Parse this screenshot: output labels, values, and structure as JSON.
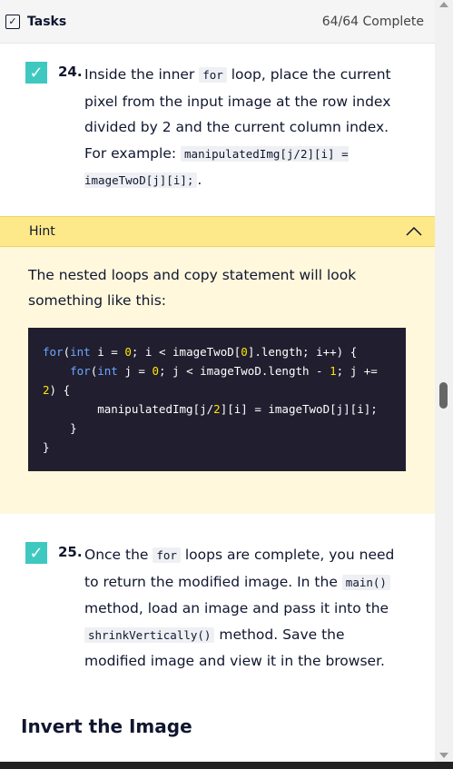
{
  "header": {
    "title": "Tasks",
    "progress": "64/64 Complete"
  },
  "task24": {
    "number": "24.",
    "text_1": "Inside the inner ",
    "code_1": "for",
    "text_2": " loop, place the current pixel from the input image at the row index divided by 2 and the current column index. For example: ",
    "code_2": "manipulatedImg[j/2][i] = imageTwoD[j][i];",
    "text_3": "."
  },
  "hint": {
    "label": "Hint",
    "text": "The nested loops and copy statement will look something like this:",
    "code_lines": [
      "for(int i = 0; i < imageTwoD[0].length; i++) {",
      "    for(int j = 0; j < imageTwoD.length - 1; j +=",
      "2) {",
      "        manipulatedImg[j/2][i] = imageTwoD[j][i];",
      "    }",
      "}"
    ]
  },
  "task25": {
    "number": "25.",
    "text_1": "Once the ",
    "code_1": "for",
    "text_2": " loops are complete, you need to return the modified image. In the ",
    "code_2": "main()",
    "text_3": " method, load an image and pass it into the ",
    "code_3": "shrinkVertically()",
    "text_4": " method. Save the modified image and view it in the browser."
  },
  "section": {
    "title": "Invert the Image"
  },
  "colors": {
    "check": "#3fc8c0",
    "hint_bar": "#fde98a",
    "hint_body": "#fff8dc",
    "code_bg": "#211e2f",
    "keyword": "#6aa8ff",
    "highlight": "#ffe600"
  }
}
